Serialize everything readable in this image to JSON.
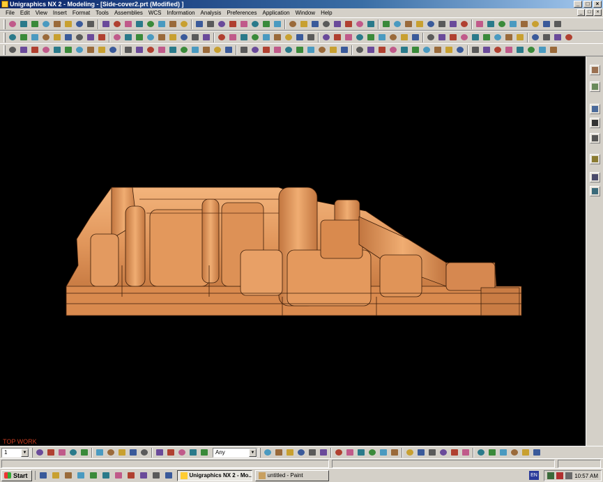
{
  "window": {
    "title": "Unigraphics NX 2 - Modeling - [Side-cover2.prt (Modified) ]",
    "controls": {
      "minimize": "_",
      "maximize": "□",
      "close": "×"
    }
  },
  "menubar": {
    "items": [
      "File",
      "Edit",
      "View",
      "Insert",
      "Format",
      "Tools",
      "Assemblies",
      "WCS",
      "Information",
      "Analysis",
      "Preferences",
      "Application",
      "Window",
      "Help"
    ]
  },
  "viewport": {
    "background": "#000000",
    "view_label": "TOP WORK",
    "model_color": "#e0955a"
  },
  "bottom_toolbar": {
    "layer_value": "1",
    "filter_value": "Any"
  },
  "taskbar": {
    "start_label": "Start",
    "tasks": [
      {
        "label": "Unigraphics NX 2 - Mo...",
        "active": true
      },
      {
        "label": "untitled - Paint",
        "active": false
      }
    ],
    "language": "EN",
    "clock": "10:57 AM"
  },
  "icons": {
    "app": "nx-app-icon",
    "start": "windows-flag-icon"
  },
  "colors": {
    "titlebar_start": "#0a246a",
    "titlebar_end": "#a6caf0",
    "chrome": "#d4d0c8",
    "view_label": "#c83c20"
  }
}
